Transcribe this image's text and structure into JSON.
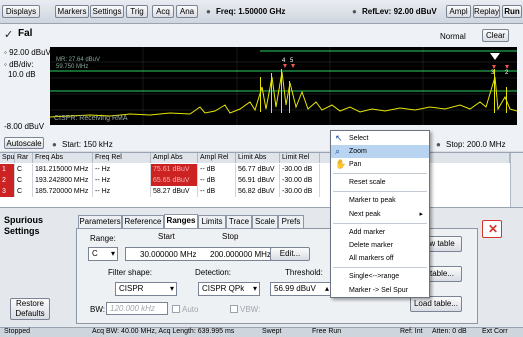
{
  "toolbar": {
    "displays": "Displays",
    "markers": "Markers",
    "settings": "Settings",
    "trig": "Trig",
    "acq": "Acq",
    "ana": "Ana",
    "freq": "Freq: 1.50000 GHz",
    "reflev": "RefLev: 92.00 dBuV",
    "ampl": "Ampl",
    "replay": "Replay",
    "run": "Run"
  },
  "plot": {
    "status": "Fal",
    "mode": "Normal",
    "clear": "Clear",
    "ref_level": "92.00 dBuV",
    "scale_label": "dB/div:",
    "scale_value": "10.0 dB",
    "bottom_level": "-8.00 dBuV",
    "marker_readout_1": "MR: 27.64 dBuV",
    "marker_readout_2": "59.750 MHz",
    "trace_info": "CISPR: Receiving RMA",
    "autoscale": "Autoscale",
    "start": "Start: 150 kHz",
    "stop": "Stop: 200.0 MHz",
    "marker_tags": [
      "4",
      "5",
      "3",
      "2"
    ]
  },
  "table": {
    "headers": [
      "Spur",
      "Rar",
      "Freq Abs",
      "Freq Rel",
      "Ampl Abs",
      "Ampl Rel",
      "Limit Abs",
      "Limit Rel"
    ],
    "rows": [
      {
        "spur": "1",
        "rar": "C",
        "freq_abs": "181.215000 MHz",
        "freq_rel": "-- Hz",
        "ampl_abs": "75.61 dBuV",
        "ampl_rel": "-- dB",
        "limit_abs": "56.77 dBuV",
        "limit_rel": "-30.00 dB"
      },
      {
        "spur": "2",
        "rar": "C",
        "freq_abs": "193.242800 MHz",
        "freq_rel": "-- Hz",
        "ampl_abs": "65.65 dBuV",
        "ampl_rel": "-- dB",
        "limit_abs": "56.91 dBuV",
        "limit_rel": "-30.00 dB"
      },
      {
        "spur": "3",
        "rar": "C",
        "freq_abs": "185.720000 MHz",
        "freq_rel": "-- Hz",
        "ampl_abs": "58.27 dBuV",
        "ampl_rel": "-- dB",
        "limit_abs": "56.82 dBuV",
        "limit_rel": "-30.00 dB"
      }
    ]
  },
  "settings_panel": {
    "title_1": "Spurious",
    "title_2": "Settings",
    "tabs": [
      "Parameters",
      "Reference",
      "Ranges",
      "Limits",
      "Trace",
      "Scale",
      "Prefs"
    ],
    "active_tab": "Ranges",
    "range_label": "Range:",
    "range_value": "C",
    "start_label": "Start",
    "stop_label": "Stop",
    "start_value": "30.000000 MHz",
    "stop_value": "200.000000 MHz",
    "edit": "Edit...",
    "filter_label": "Filter shape:",
    "filter_value": "CISPR",
    "detection_label": "Detection:",
    "detection_value": "CISPR QPk",
    "threshold_label": "Threshold:",
    "threshold_value": "56.99 dBuV",
    "bw_label": "BW:",
    "bw_value": "120.000 kHz",
    "auto_label": "Auto",
    "vbw_label": "VBW:",
    "restore_1": "Restore",
    "restore_2": "Defaults",
    "side_btn_1": "w table",
    "side_btn_2": "table...",
    "side_btn_3": "Load table..."
  },
  "context_menu": {
    "items": [
      "Select",
      "Zoom",
      "Pan",
      "Reset scale",
      "Marker to peak",
      "Next peak",
      "Add marker",
      "Delete marker",
      "All markers off",
      "Single<-->range",
      "Marker -> Sel Spur"
    ]
  },
  "status": {
    "state": "Stopped",
    "acq_bw": "Acq BW: 40.00 MHz, Acq Length: 639.995 ms",
    "swept": "Swept",
    "free_run": "Free Run",
    "ref": "Ref: Int",
    "atten": "Atten: 0 dB",
    "ext_corr": "Ext Corr"
  },
  "colors": {
    "trace": "#e6e600",
    "limit_line": "#2bd160",
    "fail": "#cc0000",
    "highlight_row": "#cc2222",
    "menu_highlight": "#b9d4f1",
    "close_button": "#d4342a"
  }
}
